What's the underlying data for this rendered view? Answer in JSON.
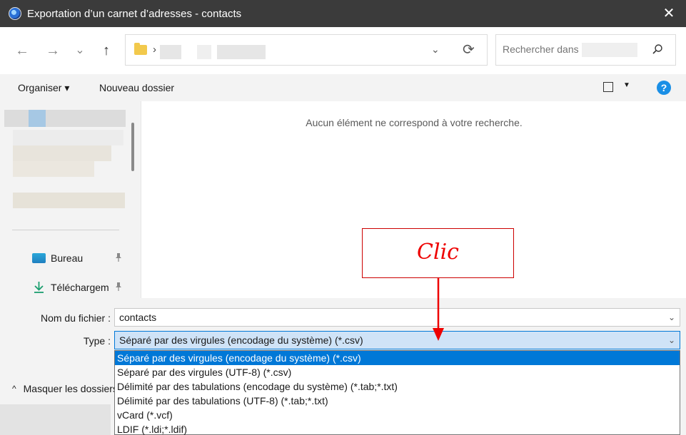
{
  "window": {
    "title": "Exportation d’un carnet d’adresses - contacts",
    "close": "✕"
  },
  "nav": {
    "back": "←",
    "forward": "→",
    "recent": "⌄",
    "up": "↑",
    "address_chevron": "›",
    "address_dropdown": "⌄",
    "refresh": "⟳"
  },
  "search": {
    "placeholder": "Rechercher dans"
  },
  "toolbar": {
    "organize": "Organiser ▾",
    "new_folder": "Nouveau dossier",
    "view_dropdown": "▼",
    "help": "?"
  },
  "sidebar": {
    "items": [
      {
        "label": "Bureau",
        "icon": "desktop-icon"
      },
      {
        "label": "Téléchargem",
        "icon": "download-icon"
      }
    ],
    "pin": "📌"
  },
  "main": {
    "empty_message": "Aucun élément ne correspond à votre recherche."
  },
  "annotation": {
    "text": "Clic",
    "color": "#e00000"
  },
  "form": {
    "filename_label": "Nom du fichier :",
    "filename_value": "contacts",
    "type_label": "Type :",
    "type_value": "Séparé par des virgules (encodage du système) (*.csv)",
    "chevron": "⌄"
  },
  "hide_folders": {
    "label": "Masquer les dossiers",
    "chevron": "^"
  },
  "type_options": [
    "Séparé par des virgules (encodage du système) (*.csv)",
    "Séparé par des virgules (UTF-8) (*.csv)",
    "Délimité par des tabulations (encodage du système) (*.tab;*.txt)",
    "Délimité par des tabulations (UTF-8) (*.tab;*.txt)",
    "vCard (*.vcf)",
    "LDIF (*.ldi;*.ldif)"
  ],
  "colors": {
    "accent": "#0078d7",
    "titlebar": "#3b3b3b"
  }
}
